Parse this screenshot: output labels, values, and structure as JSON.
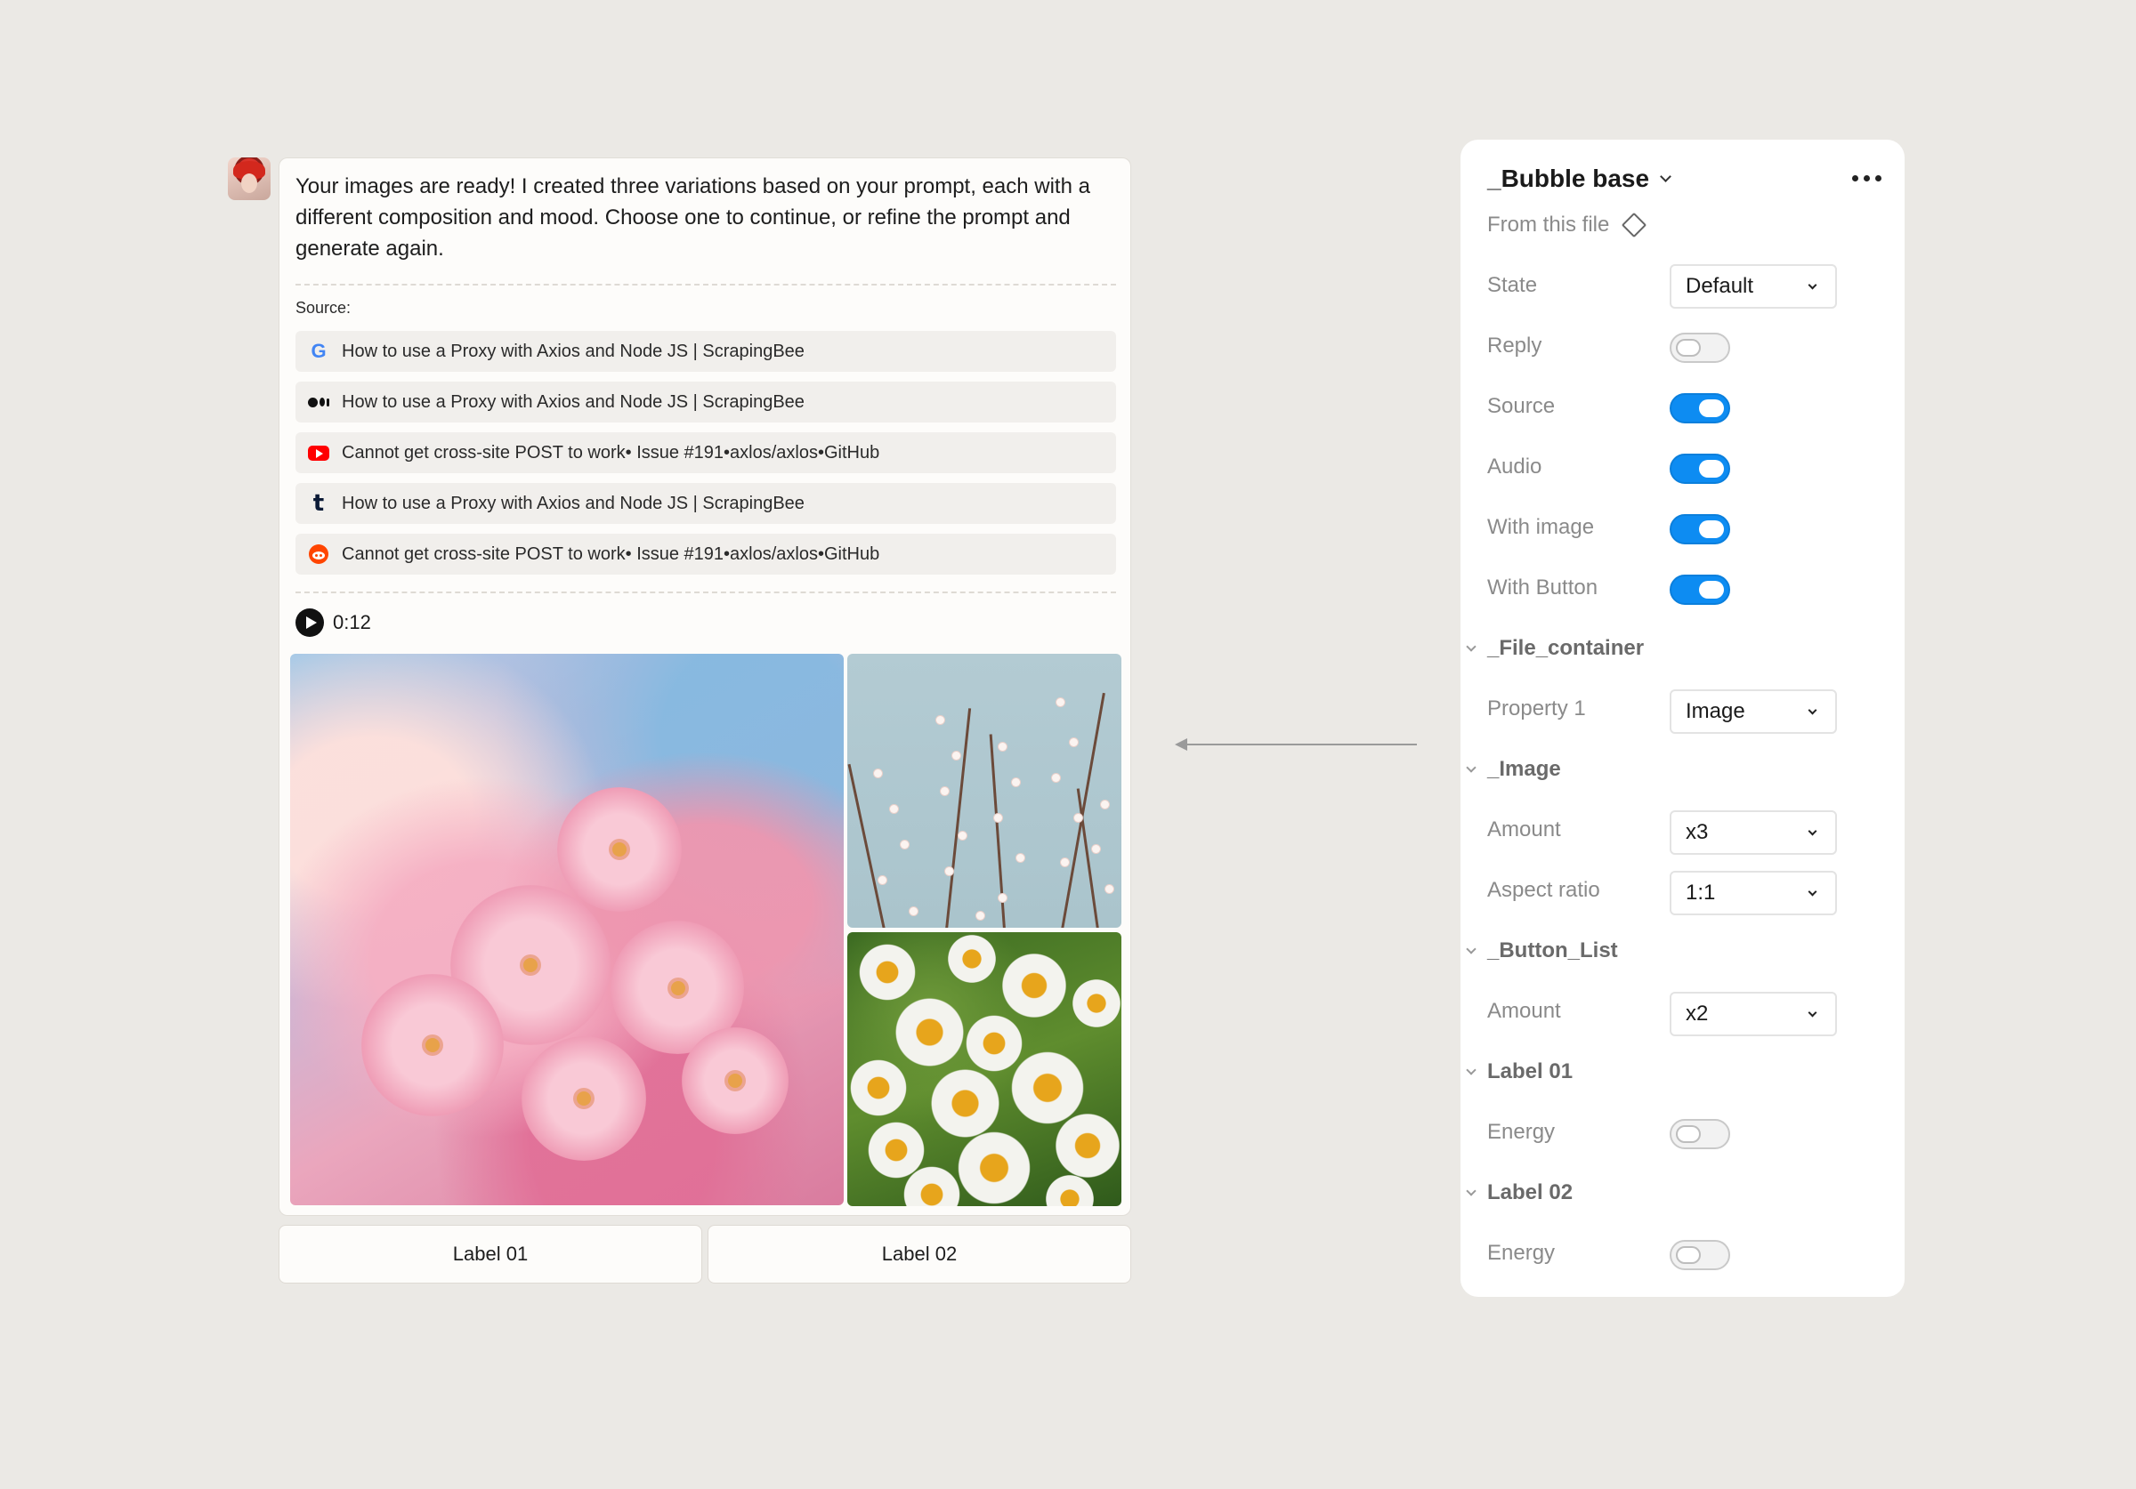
{
  "chat": {
    "message": "Your images are ready! I created three variations based on your prompt, each with a different composition and mood. Choose one to continue, or refine the prompt and generate again.",
    "source_title": "Source:",
    "sources": [
      {
        "icon": "google-icon",
        "text": "How to use a Proxy with Axios and Node JS | ScrapingBee"
      },
      {
        "icon": "medium-icon",
        "text": "How to use a Proxy with Axios and Node JS | ScrapingBee"
      },
      {
        "icon": "youtube-icon",
        "text": "Cannot get cross-site POST to work• Issue #191•axlos/axlos•GitHub"
      },
      {
        "icon": "tumblr-icon",
        "text": "How to use a Proxy with Axios and Node JS | ScrapingBee"
      },
      {
        "icon": "reddit-icon",
        "text": "Cannot get cross-site POST to work• Issue #191•axlos/axlos•GitHub"
      }
    ],
    "audio_time": "0:12",
    "buttons": [
      "Label 01",
      "Label 02"
    ]
  },
  "panel": {
    "title": "_Bubble base",
    "from_file": "From this file",
    "rows": {
      "state": {
        "label": "State",
        "value": "Default"
      },
      "reply": {
        "label": "Reply",
        "on": false
      },
      "source": {
        "label": "Source",
        "on": true
      },
      "audio": {
        "label": "Audio",
        "on": true
      },
      "with_image": {
        "label": "With image",
        "on": true
      },
      "with_button": {
        "label": "With Button",
        "on": true
      },
      "file_container": "_File_container",
      "property1": {
        "label": "Property 1",
        "value": "Image"
      },
      "image_section": "_Image",
      "image_amount": {
        "label": "Amount",
        "value": "x3"
      },
      "aspect_ratio": {
        "label": "Aspect ratio",
        "value": "1:1"
      },
      "button_list": "_Button_List",
      "button_amount": {
        "label": "Amount",
        "value": "x2"
      },
      "label01": "Label 01",
      "energy1": {
        "label": "Energy",
        "on": false
      },
      "label02": "Label 02",
      "energy2": {
        "label": "Energy",
        "on": false
      }
    }
  },
  "colors": {
    "toggle_on": "#0d8cf2",
    "background": "#ebe9e5"
  }
}
